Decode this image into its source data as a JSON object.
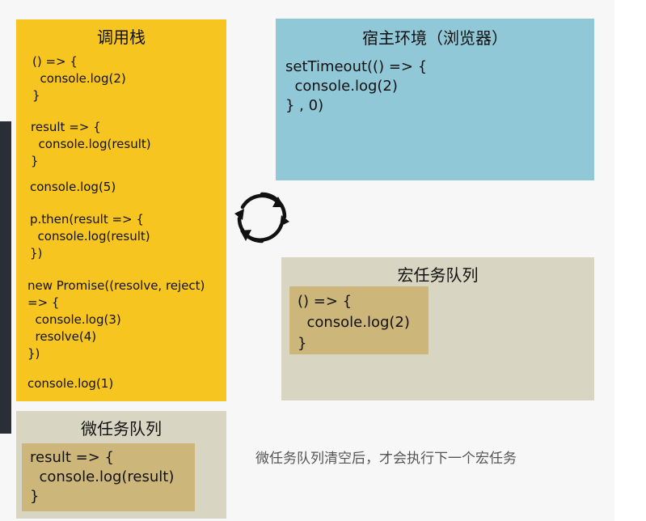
{
  "call_stack": {
    "title": "调用栈",
    "blocks": [
      "() => {\n  console.log(2)\n}",
      "result => {\n  console.log(result)\n}",
      "console.log(5)",
      "p.then(result => {\n  console.log(result)\n})",
      "new Promise((resolve, reject)\n=> {\n  console.log(3)\n  resolve(4)\n})",
      "console.log(1)"
    ]
  },
  "host_env": {
    "title": "宿主环境（浏览器）",
    "code": "setTimeout(() => {\n  console.log(2)\n} , 0)"
  },
  "macro_queue": {
    "title": "宏任务队列",
    "item": "() => {\n  console.log(2)\n}"
  },
  "micro_queue": {
    "title": "微任务队列",
    "item": "result => {\n  console.log(result)\n}"
  },
  "note": "微任务队列清空后，才会执行下一个宏任务",
  "colors": {
    "call_stack_bg": "#f7c51f",
    "host_env_bg": "#91c8d8",
    "queue_bg": "#d8d6c2",
    "task_item_bg": "#ccb679"
  },
  "icons": {
    "event_loop": "circular-arrows-icon"
  }
}
